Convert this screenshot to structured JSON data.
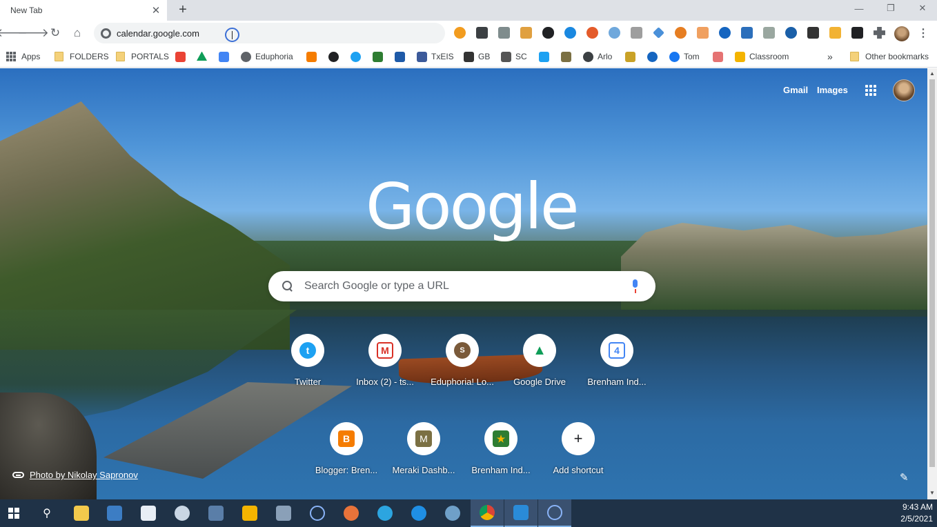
{
  "browser": {
    "tab": {
      "title": "New Tab",
      "close": "✕"
    },
    "new_tab": "+",
    "window_controls": {
      "minimize": "—",
      "maximize": "❐",
      "close": "✕"
    },
    "address_bar": {
      "url": "calendar.google.com"
    }
  },
  "bookmarks": {
    "apps": "Apps",
    "items": [
      "FOLDERS",
      "PORTALS",
      "Eduphoria",
      "TxEIS",
      "GB",
      "SC",
      "Arlo",
      "Tom",
      "Classroom"
    ],
    "overflow": "»",
    "other": "Other bookmarks"
  },
  "ntp": {
    "links": {
      "gmail": "Gmail",
      "images": "Images"
    },
    "logo": "Google",
    "search": {
      "placeholder": "Search Google or type a URL"
    },
    "shortcuts": [
      {
        "label": "Twitter",
        "icon": "twitter-icon",
        "glyph": "t",
        "color": "#1da1f2"
      },
      {
        "label": "Inbox (2) - ts...",
        "icon": "gmail-icon",
        "glyph": "M",
        "color": "#d93025"
      },
      {
        "label": "Eduphoria! Lo...",
        "icon": "eduphoria-icon",
        "glyph": "S",
        "color": "#7a5a3a"
      },
      {
        "label": "Google Drive",
        "icon": "google-drive-icon",
        "glyph": "▲",
        "color": "#0f9d58"
      },
      {
        "label": "Brenham Ind...",
        "icon": "calendar-icon",
        "glyph": "4",
        "color": "#4285f4"
      },
      {
        "label": "Blogger: Bren...",
        "icon": "blogger-icon",
        "glyph": "B",
        "color": "#f57c00"
      },
      {
        "label": "Meraki Dashb...",
        "icon": "meraki-icon",
        "glyph": "M",
        "color": "#7b7043"
      },
      {
        "label": "Brenham Ind...",
        "icon": "star-badge-icon",
        "glyph": "★",
        "color": "#c0392b"
      },
      {
        "label": "Add shortcut",
        "icon": "plus-icon",
        "glyph": "+",
        "color": "#202124"
      }
    ],
    "photo_credit": "Photo by Nikolay Sapronov"
  },
  "taskbar": {
    "clock": {
      "time": "9:43 AM",
      "date": "2/5/2021"
    }
  }
}
